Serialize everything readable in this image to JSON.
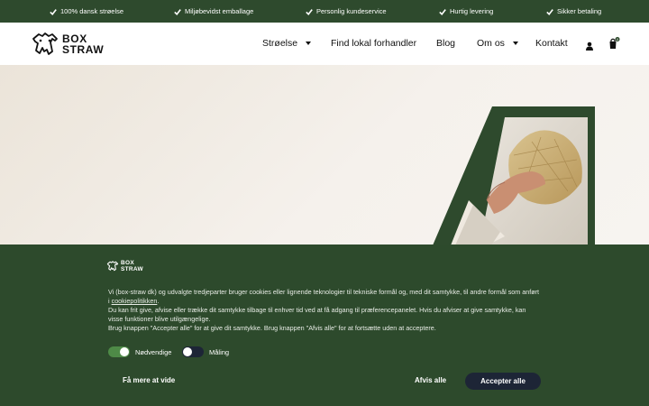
{
  "topbar": {
    "usps": [
      "100% dansk strøelse",
      "Miljøbevidst emballage",
      "Personlig kundeservice",
      "Hurtig levering",
      "Sikker betaling"
    ]
  },
  "header": {
    "logo_line1": "BOX",
    "logo_line2": "STRAW",
    "nav": {
      "item1": "Strøelse",
      "item2": "Find lokal forhandler",
      "item3": "Blog",
      "item4": "Om os",
      "item5": "Kontakt"
    },
    "cart_count": "0"
  },
  "cookie": {
    "logo_line1": "BOX",
    "logo_line2": "STRAW",
    "p1_before": "Vi (box-straw dk) og udvalgte tredjeparter bruger cookies eller lignende teknologier til tekniske formål og, med dit samtykke, til andre formål som anført i ",
    "p1_link": "cookiepolitikken",
    "p1_after": ".",
    "p2": "Du kan frit give, afvise eller trække dit samtykke tilbage til enhver tid ved at få adgang til præferencepanelet. Hvis du afviser at give samtykke, kan visse funktioner blive utilgængelige.",
    "p3": "Brug knappen \"Accepter alle\" for at give dit samtykke. Brug knappen \"Afvis alle\" for at fortsætte uden at acceptere.",
    "toggle1_label": "Nødvendige",
    "toggle2_label": "Måling",
    "learn_more": "Få mere at vide",
    "reject": "Afvis alle",
    "accept": "Accepter alle"
  },
  "colors": {
    "brand_green": "#2e4a2d",
    "accept_button": "#1d2536"
  }
}
